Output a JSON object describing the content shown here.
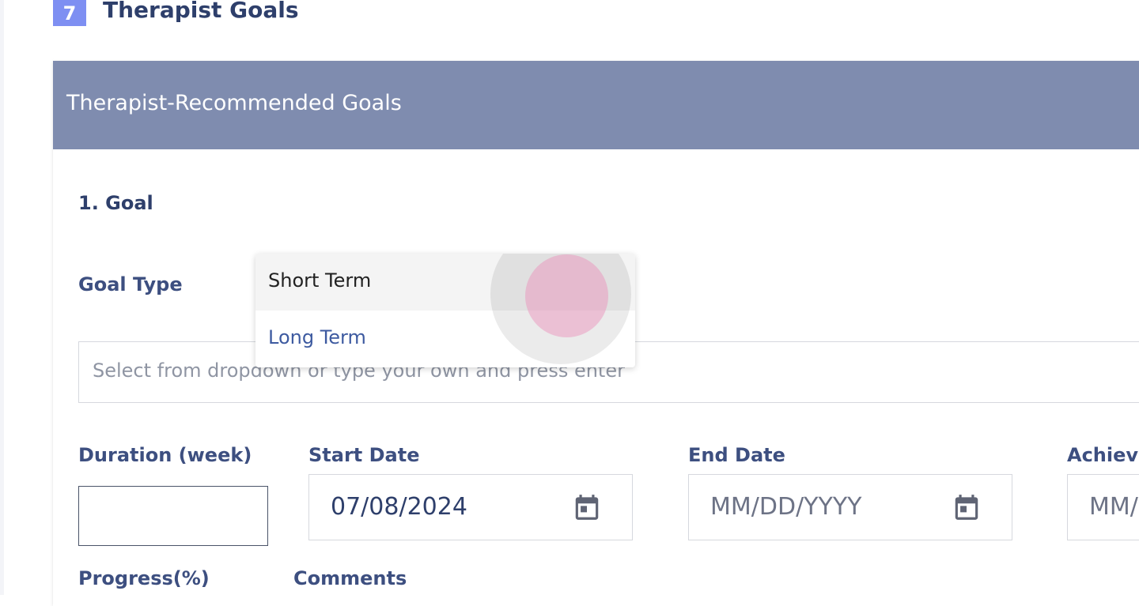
{
  "section": {
    "number": "7",
    "title": "Therapist Goals"
  },
  "card": {
    "header_title": "Therapist-Recommended Goals",
    "goal_heading": "1. Goal"
  },
  "goal_type": {
    "label": "Goal Type",
    "placeholder": "Select from dropdown or type your own and press enter",
    "options": [
      "Short Term",
      "Long Term"
    ],
    "highlighted_option": "Short Term"
  },
  "fields": {
    "duration_label": "Duration (week)",
    "duration_value": "",
    "start_date_label": "Start Date",
    "start_date_value": "07/08/2024",
    "end_date_label": "End Date",
    "end_date_placeholder": "MM/DD/YYYY",
    "achieved_label": "Achiev",
    "achieved_placeholder": "MM/",
    "progress_label": "Progress(%)",
    "comments_label": "Comments"
  },
  "colors": {
    "badge": "#7e8ff2",
    "header": "#7f8caf",
    "text_primary": "#2e3f6b",
    "option_long_term": "#3d5aa0"
  },
  "icons": {
    "date_picker": "calendar-icon"
  }
}
